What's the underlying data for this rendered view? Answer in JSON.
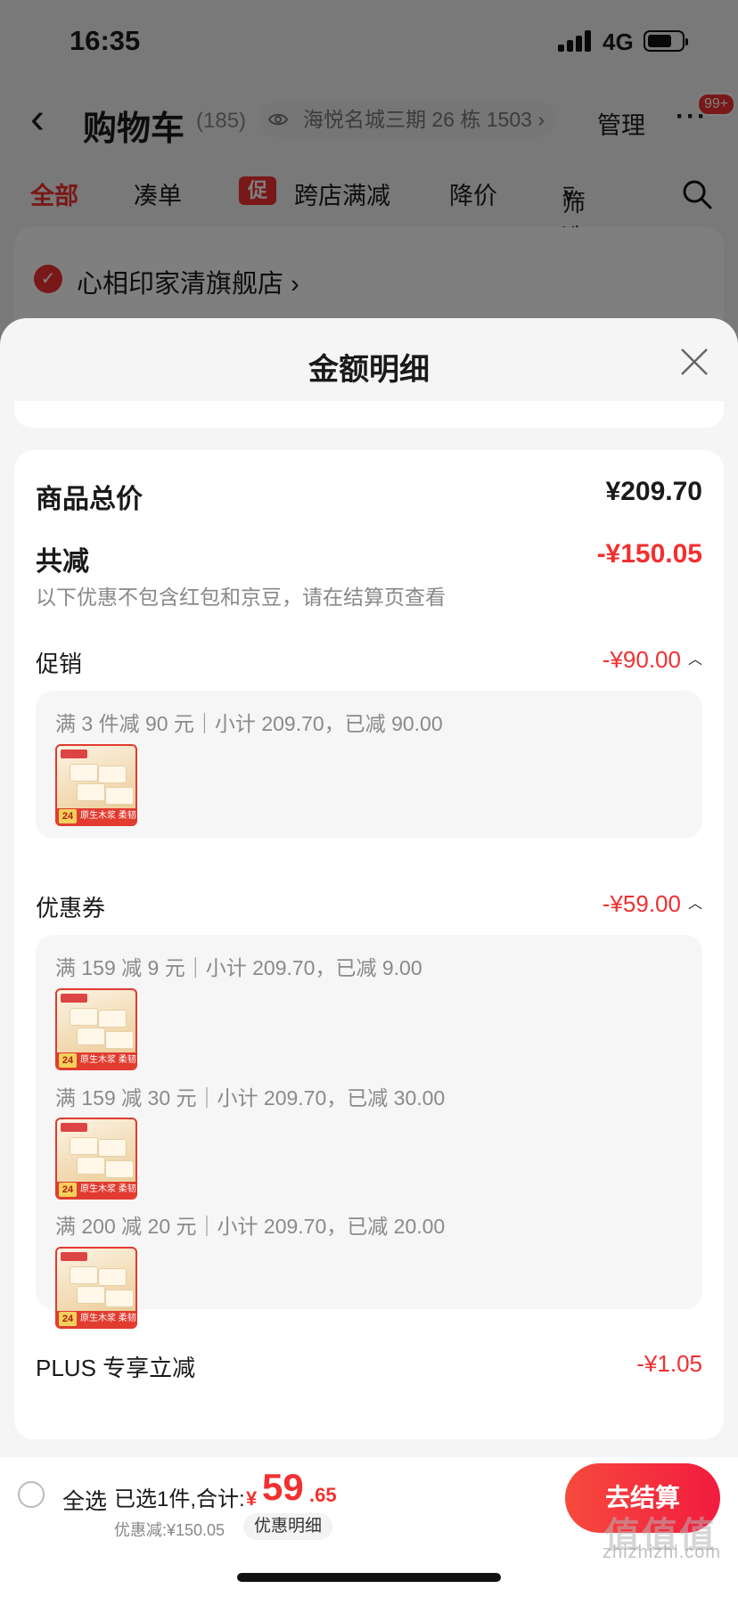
{
  "status_bar": {
    "time": "16:35",
    "network": "4G"
  },
  "cart_header": {
    "back_icon": "chevron-left-icon",
    "title": "购物车",
    "count": "(185)",
    "address": "海悦名城三期 26 栋 1503",
    "address_chevron": "›",
    "manage": "管理",
    "more": "···",
    "badge": "99+"
  },
  "cart_tabs": {
    "items": [
      {
        "label": "全部",
        "active": true
      },
      {
        "label": "凑单"
      },
      {
        "label": "跨店满减",
        "tag": "促"
      },
      {
        "label": "降价"
      },
      {
        "label": "筛选"
      }
    ]
  },
  "shop": {
    "name": "心相印家清旗舰店",
    "chevron": "›"
  },
  "sheet": {
    "title": "金额明细",
    "close_icon": "close-icon"
  },
  "breakdown": {
    "goods_total": {
      "label": "商品总价",
      "value": "¥209.70"
    },
    "total_discount": {
      "label": "共减",
      "value": "-¥150.05",
      "note": "以下优惠不包含红包和京豆，请在结算页查看"
    },
    "promotion": {
      "label": "促销",
      "value": "-¥90.00",
      "rules": [
        {
          "text": "满 3 件减 90 元｜小计 209.70，已减 90.00"
        }
      ]
    },
    "coupon": {
      "label": "优惠券",
      "value": "-¥59.00",
      "rules": [
        {
          "text": "满 159 减 9 元｜小计 209.70，已减 9.00"
        },
        {
          "text": "满 159 减 30 元｜小计 209.70，已减 30.00"
        },
        {
          "text": "满 200 减 20 元｜小计 209.70，已减 20.00"
        }
      ]
    },
    "plus": {
      "label": "PLUS 专享立减",
      "value": "-¥1.05"
    }
  },
  "product_thumb": {
    "count": "24",
    "band": "原生木浆 柔韧亲肤"
  },
  "bottom_bar": {
    "select_all": "全选",
    "selected": "已选1件,合计:",
    "currency": "¥",
    "total_int": "59",
    "total_dec": ".65",
    "saved": "优惠减:¥150.05",
    "detail_chip": "优惠明细",
    "checkout": "去结算"
  },
  "watermark": {
    "main": "值值值",
    "sub": "zhizhizhi.com"
  },
  "colors": {
    "accent": "#f23030",
    "text": "#1a1a1a",
    "muted": "#888888"
  }
}
